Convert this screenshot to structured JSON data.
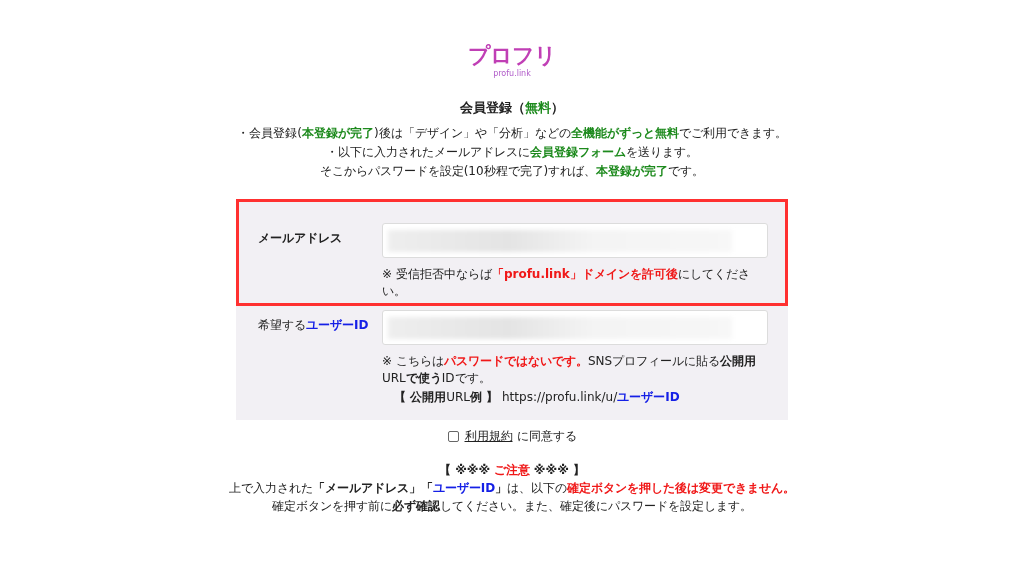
{
  "logo": {
    "wordmark": "プロフリ",
    "domain": "profu.link"
  },
  "title": [
    {
      "text": "会員登録（"
    },
    {
      "text": "無料",
      "color": "#1d8a1d"
    },
    {
      "text": "）"
    }
  ],
  "intro": [
    [
      {
        "text": "・会員登録("
      },
      {
        "text": "本登録が完了",
        "color": "#1d8a1d"
      },
      {
        "text": ")後は「デザイン」や「分析」などの"
      },
      {
        "text": "全機能がずっと無料",
        "color": "#1d8a1d"
      },
      {
        "text": "でご利用できます。"
      }
    ],
    [
      {
        "text": "・以下に入力されたメールアドレスに"
      },
      {
        "text": "会員登録フォーム",
        "color": "#1d8a1d"
      },
      {
        "text": "を送ります。"
      }
    ],
    [
      {
        "text": "そこからパスワードを設定(10秒程で完了)すれば、"
      },
      {
        "text": "本登録が完了",
        "color": "#1d8a1d"
      },
      {
        "text": "です。"
      }
    ]
  ],
  "fields": [
    {
      "label": [
        {
          "text": "**メールアドレス**"
        }
      ],
      "highlighted": true,
      "notes": [
        [
          {
            "text": "※ 受信拒否中ならば"
          },
          {
            "text": "「profu.link」**ドメインを許可後**",
            "color": "#f01818"
          },
          {
            "text": "にしてください。"
          }
        ]
      ]
    },
    {
      "label": [
        {
          "text": "希望する"
        },
        {
          "text": "**ユーザー**ID",
          "color": "#1520e6"
        }
      ],
      "highlighted": false,
      "notes": [
        [
          {
            "text": "※ こちらは"
          },
          {
            "text": "**パスワードではないです。**",
            "color": "#f01818"
          },
          {
            "text": "SNSプロフィールに貼る**公開用**URL**で使う**IDです。"
          }
        ],
        [
          {
            "text": "**【 公開用**URL**例 】** https://profu.link/u/"
          },
          {
            "text": "**ユーザー**ID",
            "color": "#1520e6"
          }
        ]
      ]
    }
  ],
  "agree": {
    "checked": false,
    "link": "利用規約",
    "text": "に同意する"
  },
  "caution": [
    [
      {
        "text": "**【 ※※※** "
      },
      {
        "text": "**ご注意**",
        "color": "#f01818"
      },
      {
        "text": " **※※※ 】**"
      }
    ],
    [
      {
        "text": "上で入力された**「メールアドレス」「**"
      },
      {
        "text": "**ユーザー**ID",
        "color": "#1520e6"
      },
      {
        "text": "**」**は、以下の"
      },
      {
        "text": "**確定ボタンを押した後は変更できません。**",
        "color": "#f01818"
      }
    ],
    [
      {
        "text": "確定ボタンを押す前に**必ず確認**してください。また、確定後にパスワードを設定します。"
      }
    ]
  ]
}
